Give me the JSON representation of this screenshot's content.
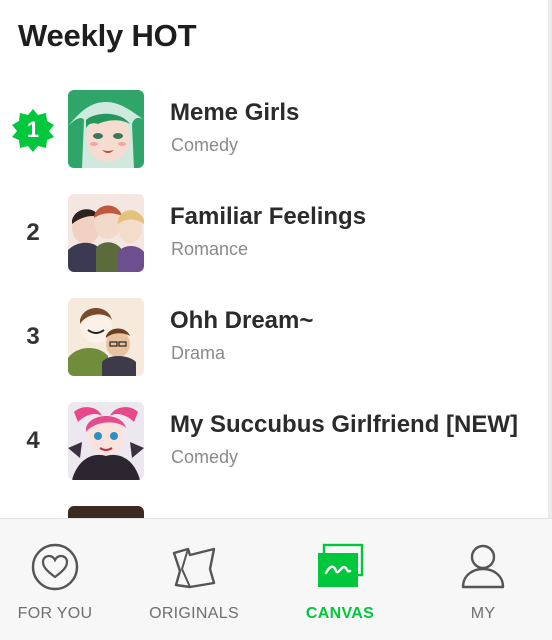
{
  "header": {
    "title": "Weekly HOT"
  },
  "items": [
    {
      "rank": "1",
      "title": "Meme Girls",
      "genre": "Comedy"
    },
    {
      "rank": "2",
      "title": "Familiar Feelings",
      "genre": "Romance"
    },
    {
      "rank": "3",
      "title": "Ohh Dream~",
      "genre": "Drama"
    },
    {
      "rank": "4",
      "title": "My Succubus Girlfriend [NEW]",
      "genre": "Comedy"
    }
  ],
  "nav": [
    {
      "label": "FOR YOU",
      "icon": "heart-icon",
      "active": false
    },
    {
      "label": "ORIGINALS",
      "icon": "originals-icon",
      "active": false
    },
    {
      "label": "CANVAS",
      "icon": "canvas-icon",
      "active": true
    },
    {
      "label": "MY",
      "icon": "person-icon",
      "active": false
    }
  ],
  "colors": {
    "accent": "#00c73c",
    "text": "#2b2b2b",
    "muted": "#8a8a8a"
  }
}
